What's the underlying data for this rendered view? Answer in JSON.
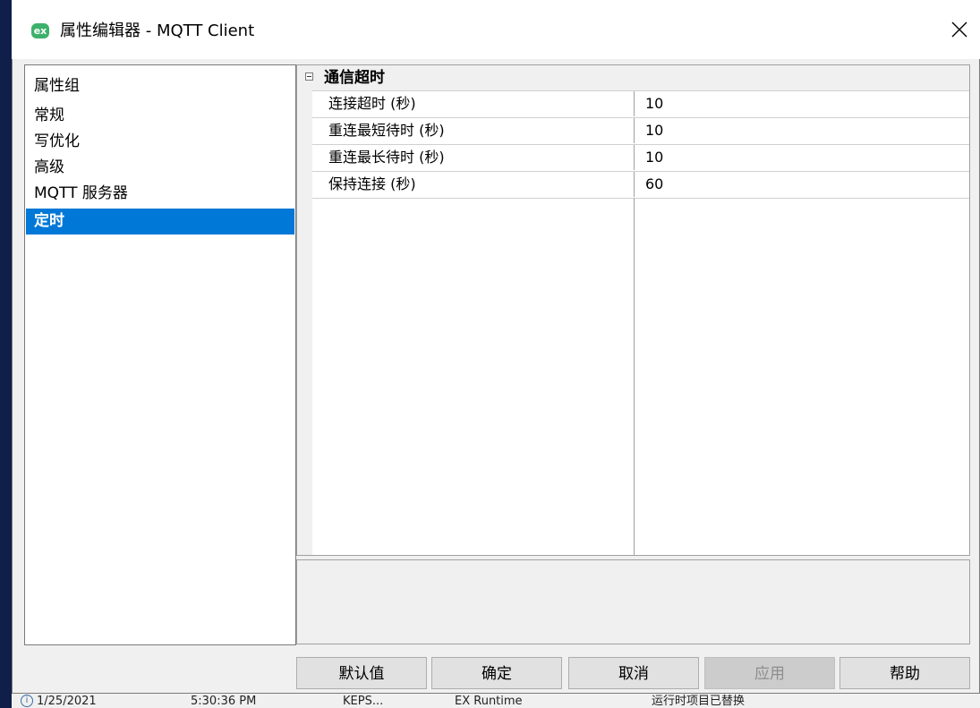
{
  "window": {
    "badge": "ex",
    "title": "属性编辑器 - MQTT Client"
  },
  "left_panel": {
    "items": [
      {
        "label": "属性组",
        "selected": false
      },
      {
        "label": "常规",
        "selected": false
      },
      {
        "label": "写优化",
        "selected": false
      },
      {
        "label": "高级",
        "selected": false
      },
      {
        "label": "MQTT 服务器",
        "selected": false
      },
      {
        "label": "定时",
        "selected": true
      }
    ]
  },
  "property_grid": {
    "category": "通信超时",
    "properties": [
      {
        "name": "连接超时 (秒)",
        "value": "10"
      },
      {
        "name": "重连最短待时 (秒)",
        "value": "10"
      },
      {
        "name": "重连最长待时 (秒)",
        "value": "10"
      },
      {
        "name": "保持连接 (秒)",
        "value": "60"
      }
    ]
  },
  "buttons": {
    "defaults": "默认值",
    "ok": "确定",
    "cancel": "取消",
    "apply": "应用",
    "help": "帮助"
  },
  "background_status": {
    "date": "1/25/2021",
    "time": "5:30:36 PM",
    "source": "KEPS...",
    "event": "EX Runtime",
    "message": "运行时项目已替换"
  },
  "colors": {
    "selection": "#0078d7",
    "badge": "#3db16b"
  }
}
